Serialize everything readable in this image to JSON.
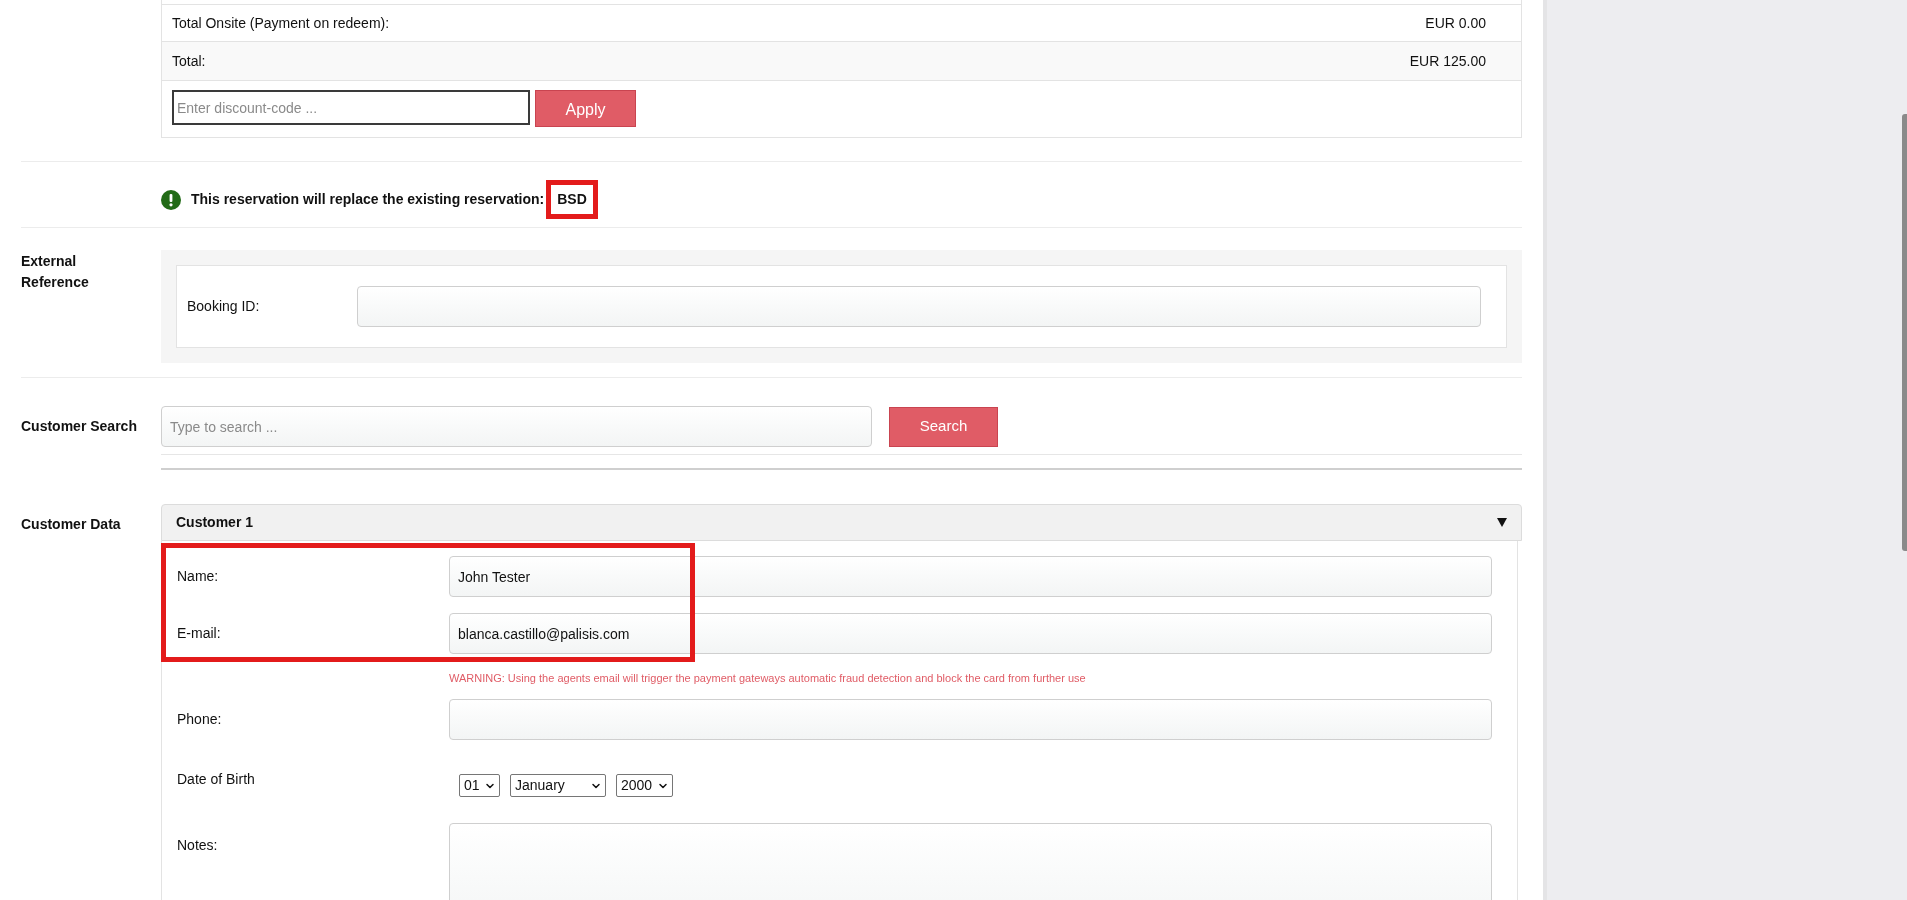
{
  "summary": {
    "rows": [
      {
        "label": "Total Onsite (Payment on redeem):",
        "amount": "EUR 0.00"
      },
      {
        "label": "Total:",
        "amount": "EUR 125.00"
      }
    ],
    "discount": {
      "placeholder": "Enter discount-code ...",
      "button": "Apply"
    }
  },
  "notice": {
    "text": "This reservation will replace the existing reservation:",
    "code": "BSD",
    "highlighted": true
  },
  "external_reference": {
    "label": "External Reference",
    "fields": [
      {
        "label": "Booking ID:"
      }
    ]
  },
  "customer_search": {
    "label": "Customer Search",
    "placeholder": "Type to search ...",
    "button": "Search"
  },
  "customer_data": {
    "label": "Customer Data",
    "panels": [
      {
        "title": "Customer 1",
        "expanded": true,
        "fields": [
          {
            "kind": "text",
            "label": "Name:",
            "value": "John Tester",
            "highlighted": true
          },
          {
            "kind": "text",
            "label": "E-mail:",
            "value": "blanca.castillo@palisis.com",
            "highlighted": true,
            "warning": "WARNING: Using the agents email will trigger the payment gateways automatic fraud detection and block the card from further use"
          },
          {
            "kind": "text",
            "label": "Phone:",
            "highlighted": false
          },
          {
            "kind": "date",
            "label": "Date of Birth",
            "day": "01",
            "month": "January",
            "year": "2000",
            "highlighted": false
          },
          {
            "kind": "textarea",
            "label": "Notes:",
            "highlighted": false
          }
        ]
      }
    ]
  }
}
